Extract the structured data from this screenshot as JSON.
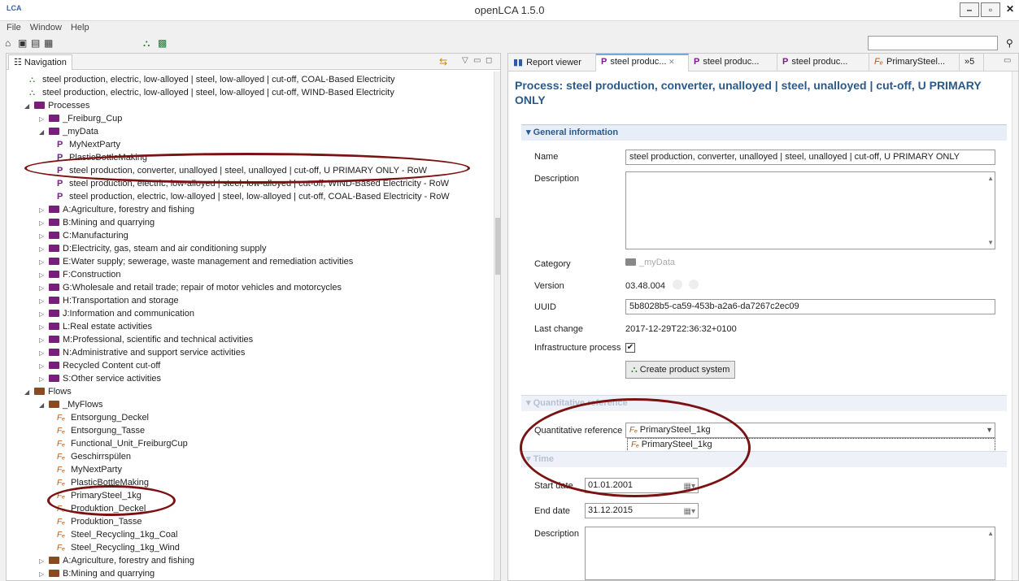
{
  "window": {
    "title": "openLCA 1.5.0",
    "logo": "LCA"
  },
  "menu": [
    "File",
    "Window",
    "Help"
  ],
  "navigation": {
    "tab_label": "Navigation",
    "rows": [
      {
        "kind": "system",
        "text": "steel production, electric, low-alloyed | steel, low-alloyed | cut-off, COAL-Based Electricity"
      },
      {
        "kind": "system",
        "text": "steel production, electric, low-alloyed | steel, low-alloyed | cut-off, WIND-Based Electricity"
      },
      {
        "kind": "folder",
        "text": "Processes",
        "expanded": true
      },
      {
        "kind": "folder",
        "text": "_Freiburg_Cup",
        "expanded": false
      },
      {
        "kind": "folder",
        "text": "_myData",
        "expanded": true
      },
      {
        "kind": "process",
        "text": "MyNextParty"
      },
      {
        "kind": "process",
        "text": "PlasticBottleMaking"
      },
      {
        "kind": "process",
        "text": "steel production, converter, unalloyed | steel, unalloyed | cut-off, U PRIMARY ONLY - RoW"
      },
      {
        "kind": "process",
        "text": "steel production, electric, low-alloyed | steel, low-alloyed | cut-off, WIND-Based Electricity - RoW"
      },
      {
        "kind": "process",
        "text": "steel production, electric, low-alloyed | steel, low-alloyed | cut-off, COAL-Based Electricity - RoW"
      },
      {
        "kind": "folder",
        "text": "A:Agriculture, forestry and fishing",
        "expanded": false
      },
      {
        "kind": "folder",
        "text": "B:Mining and quarrying",
        "expanded": false
      },
      {
        "kind": "folder",
        "text": "C:Manufacturing",
        "expanded": false
      },
      {
        "kind": "folder",
        "text": "D:Electricity, gas, steam and air conditioning supply",
        "expanded": false
      },
      {
        "kind": "folder",
        "text": "E:Water supply; sewerage, waste management and remediation activities",
        "expanded": false
      },
      {
        "kind": "folder",
        "text": "F:Construction",
        "expanded": false
      },
      {
        "kind": "folder",
        "text": "G:Wholesale and retail trade; repair of motor vehicles and motorcycles",
        "expanded": false
      },
      {
        "kind": "folder",
        "text": "H:Transportation and storage",
        "expanded": false
      },
      {
        "kind": "folder",
        "text": "J:Information and communication",
        "expanded": false
      },
      {
        "kind": "folder",
        "text": "L:Real estate activities",
        "expanded": false
      },
      {
        "kind": "folder",
        "text": "M:Professional, scientific and technical activities",
        "expanded": false
      },
      {
        "kind": "folder",
        "text": "N:Administrative and support service activities",
        "expanded": false
      },
      {
        "kind": "folder",
        "text": "Recycled Content cut-off",
        "expanded": false
      },
      {
        "kind": "folder",
        "text": "S:Other service activities",
        "expanded": false
      },
      {
        "kind": "folder-brown",
        "text": "Flows",
        "expanded": true
      },
      {
        "kind": "folder-brown",
        "text": "_MyFlows",
        "expanded": true
      },
      {
        "kind": "flow",
        "text": "Entsorgung_Deckel"
      },
      {
        "kind": "flow",
        "text": "Entsorgung_Tasse"
      },
      {
        "kind": "flow",
        "text": "Functional_Unit_FreiburgCup"
      },
      {
        "kind": "flow",
        "text": "Geschirrspülen"
      },
      {
        "kind": "flow",
        "text": "MyNextParty"
      },
      {
        "kind": "flow",
        "text": "PlasticBottleMaking"
      },
      {
        "kind": "flow",
        "text": "PrimarySteel_1kg"
      },
      {
        "kind": "flow",
        "text": "Produktion_Deckel"
      },
      {
        "kind": "flow",
        "text": "Produktion_Tasse"
      },
      {
        "kind": "flow",
        "text": "Steel_Recycling_1kg_Coal"
      },
      {
        "kind": "flow",
        "text": "Steel_Recycling_1kg_Wind"
      },
      {
        "kind": "folder-brown",
        "text": "A:Agriculture, forestry and fishing",
        "expanded": false
      },
      {
        "kind": "folder-brown",
        "text": "B:Mining and quarrying",
        "expanded": false
      }
    ]
  },
  "editor_tabs": [
    {
      "type": "report",
      "label": "Report viewer"
    },
    {
      "type": "process",
      "label": "steel produc...",
      "active": true,
      "closable": true
    },
    {
      "type": "process",
      "label": "steel produc..."
    },
    {
      "type": "process",
      "label": "steel produc..."
    },
    {
      "type": "flow",
      "label": "PrimarySteel..."
    },
    {
      "type": "overflow",
      "label": "»5"
    }
  ],
  "process": {
    "title": "Process: steel production, converter, unalloyed | steel, unalloyed | cut-off, U PRIMARY ONLY",
    "general_header": "General information",
    "name_label": "Name",
    "name_value": "steel production, converter, unalloyed | steel, unalloyed | cut-off, U PRIMARY ONLY",
    "description_label": "Description",
    "category_label": "Category",
    "category_value": "_myData",
    "version_label": "Version",
    "version_value": "03.48.004",
    "uuid_label": "UUID",
    "uuid_value": "5b8028b5-ca59-453b-a2a6-da7267c2ec09",
    "lastchange_label": "Last change",
    "lastchange_value": "2017-12-29T22:36:32+0100",
    "infra_label": "Infrastructure process",
    "infra_checked": true,
    "create_button": "Create product system",
    "quant_header": "Quantitative reference",
    "quant_label": "Quantitative reference",
    "quant_value": "PrimarySteel_1kg",
    "quant_option": "PrimarySteel_1kg",
    "time_header": "Time",
    "start_label": "Start date",
    "start_value": "01.01.2001",
    "end_label": "End date",
    "end_value": "31.12.2015",
    "time_desc_label": "Description"
  },
  "colors": {
    "annotation": "#7a1212",
    "header_blue": "#2a5a8a",
    "process_purple": "#7a1f8a"
  }
}
